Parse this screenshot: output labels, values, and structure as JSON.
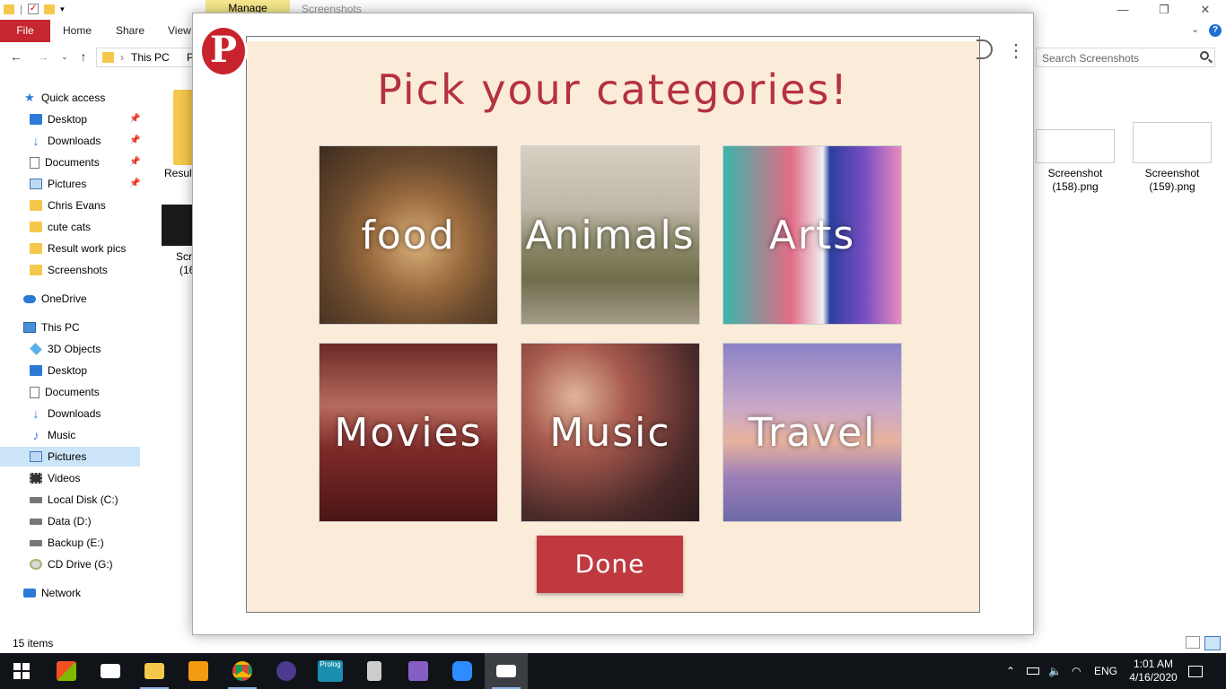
{
  "explorer": {
    "manage_tab": "Manage",
    "window_title": "Screenshots",
    "ribbon": {
      "file": "File",
      "home": "Home",
      "share": "Share",
      "view": "View"
    },
    "address": {
      "this_pc": "This PC",
      "next": "P"
    },
    "search_placeholder": "Search Screenshots",
    "nav": {
      "quick_access": "Quick access",
      "desktop": "Desktop",
      "downloads": "Downloads",
      "documents": "Documents",
      "pictures": "Pictures",
      "chris_evans": "Chris Evans",
      "cute_cats": "cute cats",
      "result_work_pics": "Result work pics",
      "screenshots": "Screenshots",
      "onedrive": "OneDrive",
      "this_pc": "This PC",
      "objects_3d": "3D Objects",
      "desktop2": "Desktop",
      "documents2": "Documents",
      "downloads2": "Downloads",
      "music": "Music",
      "pictures2": "Pictures",
      "videos": "Videos",
      "local_disk": "Local Disk (C:)",
      "data_d": "Data (D:)",
      "backup_e": "Backup (E:)",
      "cd_drive": "CD Drive (G:)",
      "network": "Network"
    },
    "files": {
      "result_label": "Result",
      "scr_label": "Scre",
      "scr_sub": "(16",
      "ss158_line1": "Screenshot",
      "ss158_line2": "(158).png",
      "ss159_line1": "Screenshot",
      "ss159_line2": "(159).png"
    },
    "status": "15 items"
  },
  "popup": {
    "logo_letter": "P",
    "title": "Pick your categories!",
    "categories": [
      {
        "label": "food"
      },
      {
        "label": "Animals"
      },
      {
        "label": "Arts"
      },
      {
        "label": "Movies"
      },
      {
        "label": "Music"
      },
      {
        "label": "Travel"
      }
    ],
    "done": "Done",
    "colors": {
      "accent": "#c0393f",
      "background": "#fbecd9"
    }
  },
  "taskbar": {
    "language": "ENG",
    "time": "1:01 AM",
    "date": "4/16/2020",
    "prolog_label": "Prolog"
  }
}
